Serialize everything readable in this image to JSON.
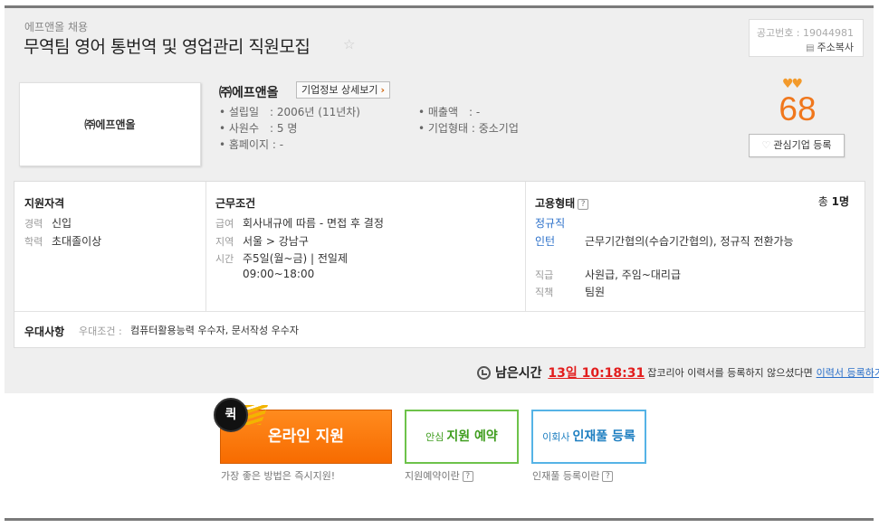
{
  "header": {
    "company_small": "에프앤올 채용",
    "title": "무역팀 영어 통번역 및 영업관리 직원모집",
    "notice_number": "공고번호 : 19044981",
    "address_copy": "주소복사"
  },
  "company": {
    "logo_text": "㈜에프앤올",
    "name": "㈜에프앤올",
    "detail_button": "기업정보 상세보기",
    "info_left": [
      "• 설립일　: 2006년 (11년차)",
      "• 사원수　: 5 명",
      "• 홈페이지 : -"
    ],
    "info_right": [
      "• 매출액　: -",
      "• 기업형태 : 중소기업"
    ],
    "score": "68",
    "fav_button": "관심기업 등록"
  },
  "requirements": {
    "title": "지원자격",
    "rows": [
      {
        "key": "경력",
        "value": "신입"
      },
      {
        "key": "학력",
        "value": "초대졸이상"
      }
    ]
  },
  "conditions": {
    "title": "근무조건",
    "rows": [
      {
        "key": "급여",
        "value": "회사내규에 따름 - 면접 후 결정"
      },
      {
        "key": "지역",
        "value": "서울 > 강남구"
      },
      {
        "key": "시간",
        "value": "주5일(월~금) | 전일제"
      }
    ],
    "time_extra": "09:00~18:00"
  },
  "employment": {
    "title": "고용형태",
    "total_label": "총",
    "total_value": "1명",
    "type1": "정규직",
    "type2": "인턴",
    "type2_desc": "근무기간협의(수습기간협의), 정규직 전환가능",
    "rows": [
      {
        "key": "직급",
        "value": "사원급, 주임~대리급"
      },
      {
        "key": "직책",
        "value": "팀원"
      }
    ]
  },
  "preference": {
    "title": "우대사항",
    "key": "우대조건 :",
    "value": "컴퓨터활용능력 우수자, 문서작성 우수자"
  },
  "remaining": {
    "label": "남은시간",
    "time": "13일 10:18:31",
    "message": "잡코리아 이력서를 등록하지 않으셨다면",
    "link": "이력서 등록하기"
  },
  "actions": {
    "quick_label": "퀵",
    "online_apply": "온라인 지원",
    "reserve_small": "안심",
    "reserve_big": "지원 예약",
    "pool_small": "이회사",
    "pool_big": "인재풀 등록",
    "online_sub": "가장 좋은 방법은 즉시지원!",
    "reserve_sub": "지원예약이란",
    "pool_sub": "인재풀 등록이란"
  }
}
